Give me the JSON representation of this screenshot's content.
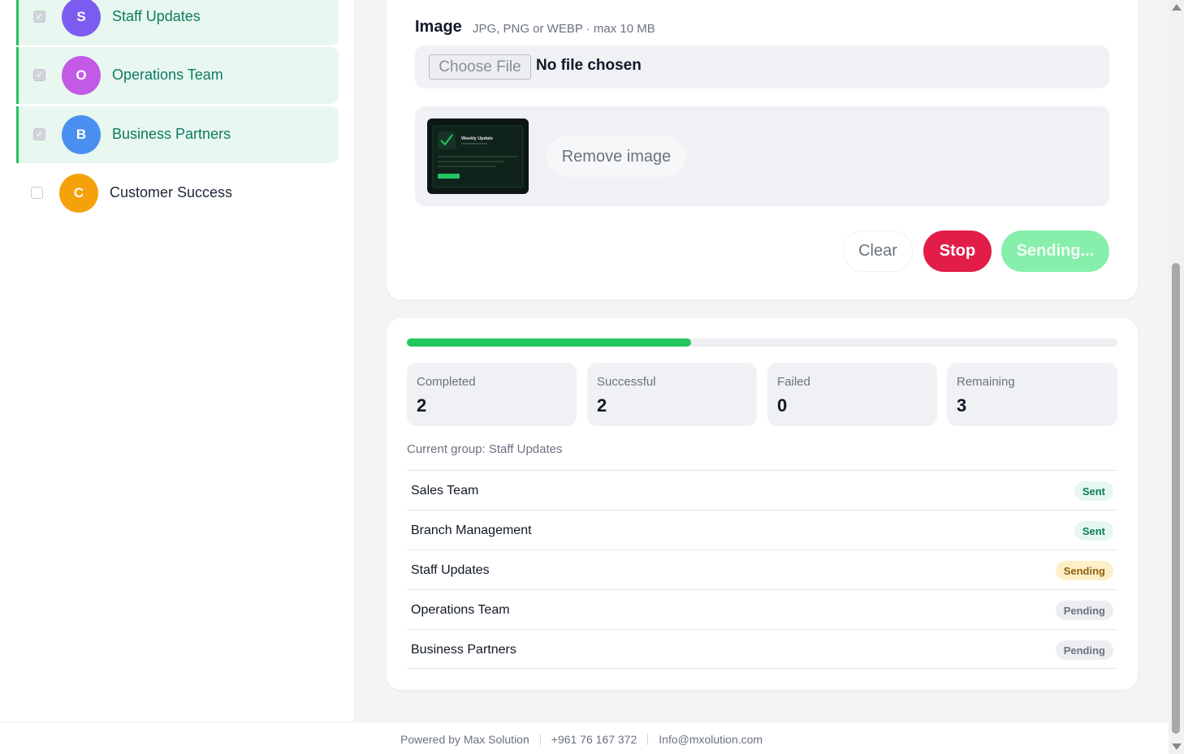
{
  "sidebar": {
    "groups": [
      {
        "initial": "S",
        "name": "Staff Updates",
        "selected": true,
        "color": "#7c5cf0"
      },
      {
        "initial": "O",
        "name": "Operations Team",
        "selected": true,
        "color": "#c25ae6"
      },
      {
        "initial": "B",
        "name": "Business Partners",
        "selected": true,
        "color": "#4a8ff0"
      },
      {
        "initial": "C",
        "name": "Customer Success",
        "selected": false,
        "color": "#f5a10a"
      }
    ]
  },
  "composer": {
    "image_label": "Image",
    "image_hint": "JPG, PNG or WEBP · max 10 MB",
    "choose_file": "Choose File",
    "no_file": "No file chosen",
    "thumb_title": "Weekly Update",
    "remove_image": "Remove image",
    "clear": "Clear",
    "stop": "Stop",
    "sending": "Sending..."
  },
  "progress": {
    "fraction": 0.4,
    "stats": [
      {
        "label": "Completed",
        "value": "2"
      },
      {
        "label": "Successful",
        "value": "2"
      },
      {
        "label": "Failed",
        "value": "0"
      },
      {
        "label": "Remaining",
        "value": "3"
      }
    ],
    "current_group": "Current group: Staff Updates",
    "rows": [
      {
        "name": "Sales Team",
        "status": "Sent",
        "kind": "sent"
      },
      {
        "name": "Branch Management",
        "status": "Sent",
        "kind": "sent"
      },
      {
        "name": "Staff Updates",
        "status": "Sending",
        "kind": "sending"
      },
      {
        "name": "Operations Team",
        "status": "Pending",
        "kind": "pending"
      },
      {
        "name": "Business Partners",
        "status": "Pending",
        "kind": "pending"
      }
    ]
  },
  "footer": {
    "powered": "Powered by Max Solution",
    "phone": "+961 76 167 372",
    "email": "Info@mxolution.com"
  },
  "colors": {
    "accent": "#22c55e",
    "stop": "#e11d48",
    "sending": "#86efac"
  }
}
